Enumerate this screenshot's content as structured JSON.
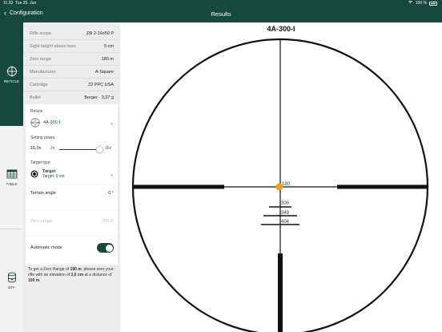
{
  "status": {
    "time": "11:33",
    "date": "Tue 25. Jun",
    "battery": "100 %"
  },
  "header": {
    "back_label": "Configuration",
    "title": "Results"
  },
  "rail": {
    "items": [
      {
        "label": "RETICLE",
        "icon": "crosshair-icon",
        "active": true
      },
      {
        "label": "TABLE",
        "icon": "table-icon",
        "active": false
      },
      {
        "label": "BTF",
        "icon": "bullet-icon",
        "active": false
      }
    ]
  },
  "info": {
    "rows": [
      {
        "label": "Rifle scope",
        "value": "Z8i 2-16x50 P"
      },
      {
        "label": "Sight height above bore",
        "value": "5 cm"
      },
      {
        "label": "Zero range",
        "value": "180 m"
      },
      {
        "label": "Manufacturer",
        "value": "A-Square"
      },
      {
        "label": "Cartridge",
        "value": ".22 PPC USA"
      },
      {
        "label": "Bullet",
        "value": "Berger · 3,37 g"
      }
    ]
  },
  "reticle": {
    "label": "Reticle",
    "value": "4A-300-I"
  },
  "power": {
    "label": "Setting power",
    "current": "16,0x",
    "min": "2x",
    "max": "16x",
    "level": 0.95
  },
  "target": {
    "label": "Target type",
    "name": "Target",
    "sub": "Target: 0 cm"
  },
  "terrain": {
    "label": "Terrain angle",
    "value": "0 °"
  },
  "zero_range": {
    "label": "Zero range",
    "value": "180 m"
  },
  "automatic": {
    "label": "Automatic mode",
    "on": true
  },
  "hint": {
    "p1": "To get a Zero Range of ",
    "b1": "180 m",
    "p2": ", please zero your rifle with an elevation of ",
    "b2": "2,6 cm",
    "p3": " at a distance of ",
    "b3": "100 m",
    "p4": "."
  },
  "scope": {
    "title": "4A-300-I",
    "marks": [
      {
        "label": "180"
      },
      {
        "label": "300"
      },
      {
        "label": "349"
      },
      {
        "label": "404"
      }
    ],
    "dot_color": "#f29a1f"
  },
  "colors": {
    "brand": "#17483c",
    "accent": "#f29a1f"
  }
}
